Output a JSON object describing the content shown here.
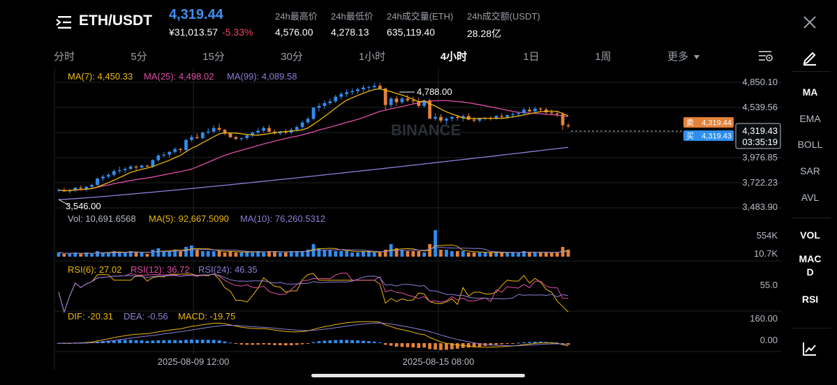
{
  "header": {
    "pair": "ETH/USDT",
    "last_price": "4,319.44",
    "cny_price": "¥31,013.57",
    "change_pct": "-5.33%",
    "stats": [
      {
        "label": "24h最高价",
        "value": "4,576.00"
      },
      {
        "label": "24h最低价",
        "value": "4,278.13"
      },
      {
        "label": "24h成交量(ETH)",
        "value": "635,119.40"
      },
      {
        "label": "24h成交额(USDT)",
        "value": "28.28亿"
      }
    ]
  },
  "intervals": {
    "tabs": [
      "分时",
      "5分",
      "15分",
      "30分",
      "1小时",
      "4小时",
      "1日",
      "1周"
    ],
    "active": "4小时",
    "more_label": "更多"
  },
  "side_indicators": {
    "main": [
      "MA",
      "EMA",
      "BOLL",
      "SAR",
      "AVL"
    ],
    "sub_top": [
      "VOL"
    ],
    "macd_lines": [
      "MAC",
      "D"
    ],
    "sub_bottom": [
      "RSI"
    ],
    "active": [
      "MA",
      "VOL",
      "MACD",
      "RSI"
    ]
  },
  "chart_legends": {
    "ma": [
      {
        "text": "MA(7): 4,450.33",
        "color": "#f0b90b"
      },
      {
        "text": "MA(25): 4,498.02",
        "color": "#e04fa8"
      },
      {
        "text": "MA(99): 4,089.58",
        "color": "#8e7fd9"
      }
    ],
    "vol": [
      {
        "text": "Vol: 10,691.6568",
        "color": "#b7bdc6"
      },
      {
        "text": "MA(5): 92,667.5090",
        "color": "#f0b90b"
      },
      {
        "text": "MA(10): 76,260.5312",
        "color": "#8e7fd9"
      }
    ],
    "rsi": [
      {
        "text": "RSI(6): 27.02",
        "color": "#f0b90b"
      },
      {
        "text": "RSI(12): 36.72",
        "color": "#e04fa8"
      },
      {
        "text": "RSI(24): 46.35",
        "color": "#8e7fd9"
      }
    ],
    "macd": [
      {
        "text": "DIF: -20.31",
        "color": "#f0b90b"
      },
      {
        "text": "DEA: -0.56",
        "color": "#8e7fd9"
      },
      {
        "text": "MACD: -19.75",
        "color": "#f0b90b"
      }
    ]
  },
  "price_axis": [
    "4,850.10",
    "4,539.56",
    "3,976.85",
    "3,722.23",
    "3,483.90"
  ],
  "vol_axis": [
    "554K",
    "10.7K"
  ],
  "rsi_axis": [
    "55.0"
  ],
  "macd_axis": [
    "160.00",
    "0.00"
  ],
  "time_axis": [
    "2025-08-09 12:00",
    "2025-08-15 08:00"
  ],
  "annotations": {
    "high": "4,788.00",
    "low": "3,546.00",
    "watermark": "BINANCE",
    "ask_label": "卖",
    "ask_price": "4,319.44",
    "bid_label": "买",
    "bid_price": "4,319.43",
    "current_price": "4,319.43",
    "countdown": "03:35:19"
  },
  "colors": {
    "up": "#2e8ef0",
    "down": "#e3823a",
    "ma7": "#f0b90b",
    "ma25": "#e04fa8",
    "ma99": "#8e7fd9",
    "last_price": "#3d8ff0",
    "negative": "#f6465d"
  },
  "chart_data": {
    "type": "candlestick",
    "price_range": [
      3483.9,
      4850.1
    ],
    "high_marker": 4788.0,
    "low_marker": 3546.0,
    "current": 4319.43,
    "ma99_range": [
      3520,
      4089.58
    ],
    "candles": [
      [
        3620,
        3640,
        3600,
        3625
      ],
      [
        3625,
        3650,
        3605,
        3610
      ],
      [
        3610,
        3640,
        3590,
        3620
      ],
      [
        3620,
        3660,
        3600,
        3650
      ],
      [
        3650,
        3672,
        3620,
        3640
      ],
      [
        3640,
        3665,
        3610,
        3660
      ],
      [
        3660,
        3690,
        3640,
        3680
      ],
      [
        3680,
        3760,
        3670,
        3750
      ],
      [
        3750,
        3790,
        3720,
        3770
      ],
      [
        3770,
        3810,
        3750,
        3790
      ],
      [
        3790,
        3850,
        3770,
        3830
      ],
      [
        3830,
        3880,
        3810,
        3840
      ],
      [
        3840,
        3875,
        3810,
        3855
      ],
      [
        3855,
        3900,
        3840,
        3880
      ],
      [
        3880,
        3895,
        3840,
        3870
      ],
      [
        3870,
        3905,
        3860,
        3890
      ],
      [
        3890,
        3900,
        3870,
        3880
      ],
      [
        3880,
        3960,
        3865,
        3950
      ],
      [
        3950,
        4020,
        3930,
        4000
      ],
      [
        4000,
        4040,
        3980,
        4010
      ],
      [
        4010,
        4050,
        3980,
        4040
      ],
      [
        4040,
        4090,
        4020,
        4070
      ],
      [
        4070,
        4085,
        4030,
        4060
      ],
      [
        4060,
        4180,
        4050,
        4170
      ],
      [
        4170,
        4225,
        4150,
        4200
      ],
      [
        4200,
        4240,
        4180,
        4190
      ],
      [
        4190,
        4260,
        4175,
        4250
      ],
      [
        4250,
        4300,
        4230,
        4260
      ],
      [
        4260,
        4330,
        4240,
        4300
      ],
      [
        4300,
        4345,
        4260,
        4280
      ],
      [
        4280,
        4290,
        4220,
        4240
      ],
      [
        4240,
        4250,
        4190,
        4200
      ],
      [
        4200,
        4215,
        4170,
        4180
      ],
      [
        4180,
        4200,
        4160,
        4190
      ],
      [
        4190,
        4230,
        4170,
        4220
      ],
      [
        4220,
        4260,
        4200,
        4250
      ],
      [
        4250,
        4300,
        4230,
        4270
      ],
      [
        4270,
        4320,
        4250,
        4300
      ],
      [
        4300,
        4330,
        4250,
        4260
      ],
      [
        4260,
        4285,
        4230,
        4240
      ],
      [
        4240,
        4270,
        4220,
        4260
      ],
      [
        4260,
        4290,
        4230,
        4250
      ],
      [
        4250,
        4300,
        4230,
        4280
      ],
      [
        4280,
        4330,
        4260,
        4310
      ],
      [
        4310,
        4380,
        4290,
        4360
      ],
      [
        4360,
        4420,
        4340,
        4400
      ],
      [
        4400,
        4530,
        4380,
        4520
      ],
      [
        4520,
        4570,
        4480,
        4540
      ],
      [
        4540,
        4600,
        4510,
        4570
      ],
      [
        4570,
        4620,
        4550,
        4590
      ],
      [
        4590,
        4660,
        4570,
        4640
      ],
      [
        4640,
        4690,
        4610,
        4670
      ],
      [
        4670,
        4720,
        4640,
        4690
      ],
      [
        4690,
        4730,
        4660,
        4700
      ],
      [
        4700,
        4740,
        4670,
        4720
      ],
      [
        4720,
        4770,
        4690,
        4740
      ],
      [
        4740,
        4760,
        4700,
        4745
      ],
      [
        4745,
        4790,
        4720,
        4760
      ],
      [
        4760,
        4788,
        4720,
        4730
      ],
      [
        4730,
        4740,
        4500,
        4550
      ],
      [
        4550,
        4640,
        4520,
        4620
      ],
      [
        4620,
        4650,
        4540,
        4580
      ],
      [
        4580,
        4640,
        4560,
        4620
      ],
      [
        4620,
        4660,
        4580,
        4600
      ],
      [
        4600,
        4640,
        4560,
        4590
      ],
      [
        4590,
        4630,
        4520,
        4540
      ],
      [
        4540,
        4610,
        4520,
        4600
      ],
      [
        4600,
        4620,
        4500,
        4400
      ],
      [
        4400,
        4460,
        4380,
        4420
      ],
      [
        4420,
        4450,
        4360,
        4380
      ],
      [
        4380,
        4420,
        4340,
        4400
      ],
      [
        4400,
        4430,
        4370,
        4420
      ],
      [
        4420,
        4440,
        4380,
        4410
      ],
      [
        4410,
        4450,
        4370,
        4430
      ],
      [
        4430,
        4460,
        4380,
        4390
      ],
      [
        4390,
        4420,
        4360,
        4380
      ],
      [
        4380,
        4410,
        4360,
        4400
      ],
      [
        4400,
        4420,
        4380,
        4410
      ],
      [
        4410,
        4430,
        4380,
        4400
      ],
      [
        4400,
        4440,
        4390,
        4430
      ],
      [
        4430,
        4460,
        4400,
        4420
      ],
      [
        4420,
        4450,
        4400,
        4440
      ],
      [
        4440,
        4470,
        4410,
        4450
      ],
      [
        4450,
        4480,
        4420,
        4460
      ],
      [
        4460,
        4520,
        4440,
        4500
      ],
      [
        4500,
        4530,
        4470,
        4480
      ],
      [
        4480,
        4530,
        4460,
        4510
      ],
      [
        4510,
        4525,
        4480,
        4500
      ],
      [
        4500,
        4520,
        4450,
        4470
      ],
      [
        4470,
        4500,
        4440,
        4460
      ],
      [
        4460,
        4480,
        4420,
        4450
      ],
      [
        4450,
        4470,
        4278,
        4330
      ],
      [
        4330,
        4350,
        4300,
        4319
      ]
    ],
    "volume": [
      3,
      2,
      2,
      3,
      2,
      3,
      2,
      4,
      3,
      3,
      4,
      3,
      3,
      4,
      3,
      3,
      2,
      5,
      6,
      4,
      4,
      5,
      4,
      7,
      8,
      5,
      4,
      4,
      4,
      4,
      3,
      4,
      3,
      3,
      4,
      3,
      4,
      3,
      4,
      4,
      3,
      3,
      4,
      4,
      4,
      5,
      9,
      6,
      5,
      5,
      4,
      4,
      4,
      3,
      3,
      4,
      4,
      3,
      3,
      5,
      9,
      6,
      5,
      4,
      4,
      4,
      3,
      9,
      19,
      5,
      5,
      4,
      4,
      4,
      3,
      3,
      3,
      3,
      3,
      3,
      3,
      3,
      3,
      3,
      4,
      3,
      3,
      3,
      3,
      3,
      3,
      7,
      5
    ],
    "volume_max": 554
  }
}
